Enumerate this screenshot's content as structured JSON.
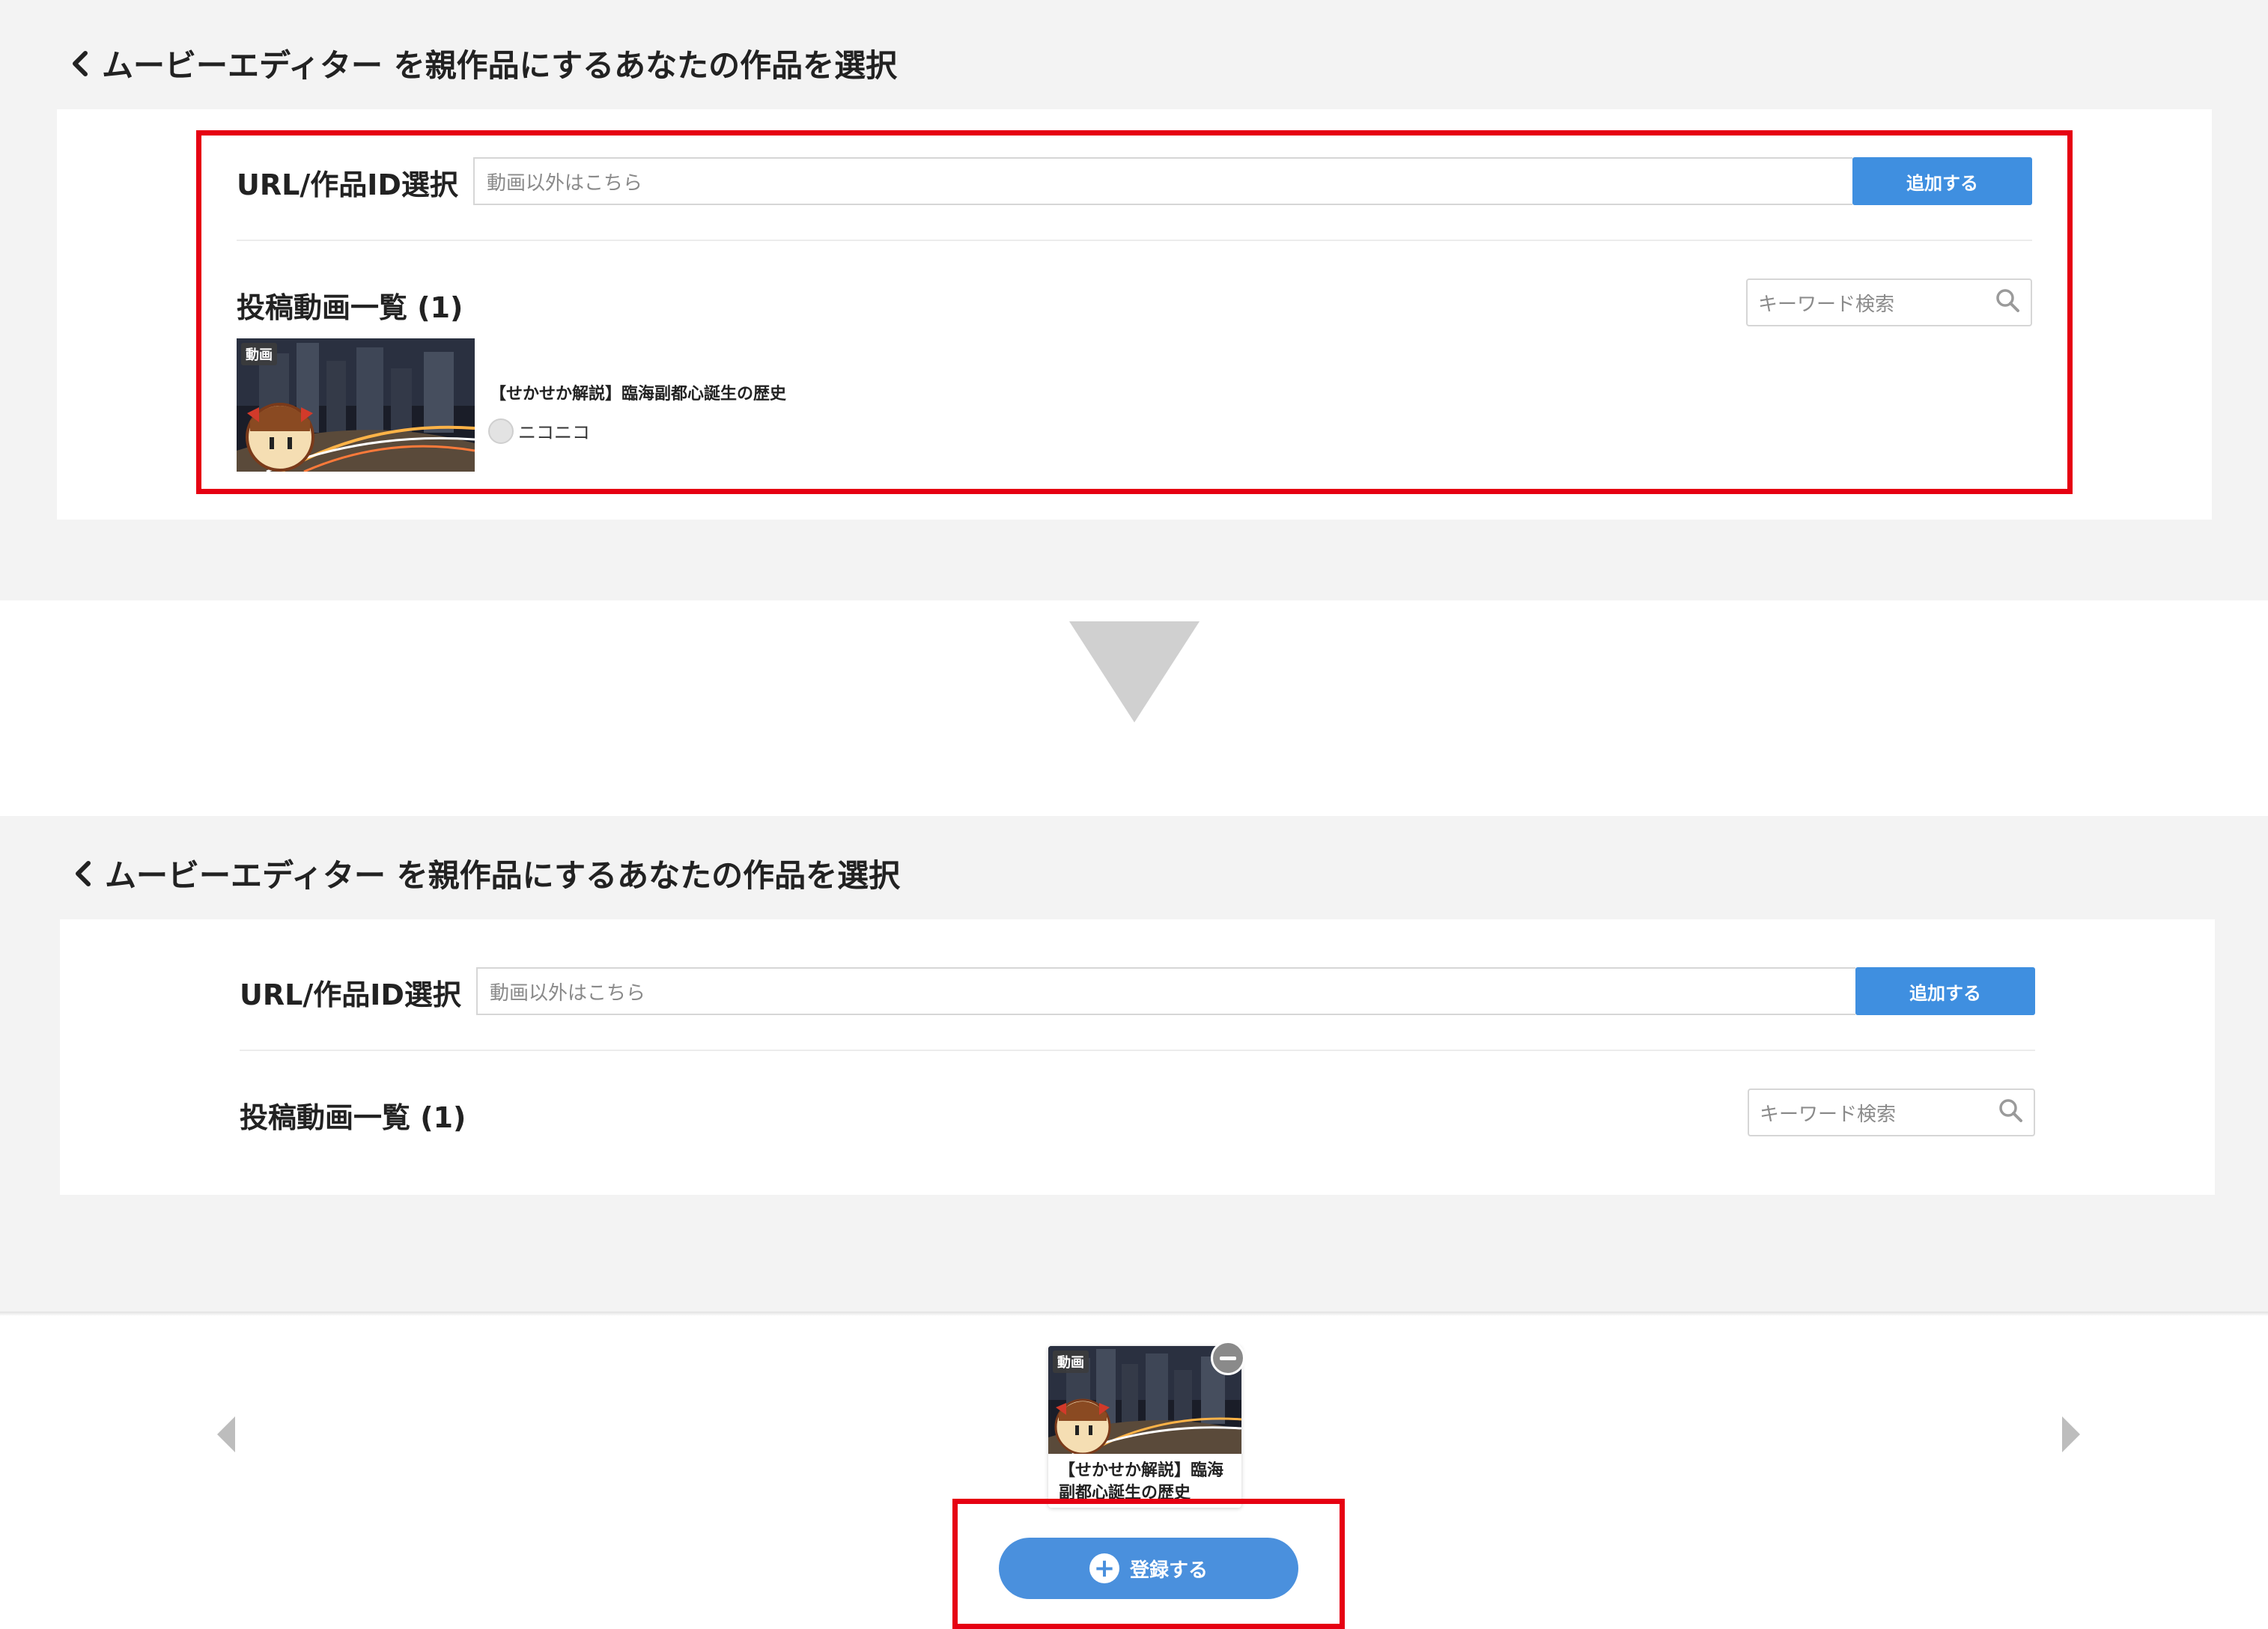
{
  "top_panel": {
    "heading": "ムービーエディター を親作品にするあなたの作品を選択",
    "url_row": {
      "label": "URL/作品ID選択",
      "placeholder": "動画以外はこちら",
      "add_button": "追加する"
    },
    "list": {
      "title": "投稿動画一覧 (1)",
      "search_placeholder": "キーワード検索",
      "items": [
        {
          "badge": "動画",
          "title": "【せかせか解説】臨海副都心誕生の歴史",
          "channel": "ニコニコ"
        }
      ]
    }
  },
  "bottom_panel": {
    "heading": "ムービーエディター を親作品にするあなたの作品を選択",
    "url_row": {
      "label": "URL/作品ID選択",
      "placeholder": "動画以外はこちら",
      "add_button": "追加する"
    },
    "list": {
      "title": "投稿動画一覧 (1)",
      "search_placeholder": "キーワード検索"
    }
  },
  "selection_tray": {
    "selected_items": [
      {
        "badge": "動画",
        "title": "【せかせか解説】臨海副都心誕生の歴史"
      }
    ],
    "register_button": "登録する"
  },
  "colors": {
    "accent": "#3f8fe0",
    "highlight": "#e60012",
    "panel_background": "#f3f3f3"
  },
  "icons": [
    "chevron-left-icon",
    "search-icon",
    "down-arrow-icon",
    "minus-circle-icon",
    "plus-circle-icon",
    "arrow-left-icon",
    "arrow-right-icon"
  ]
}
